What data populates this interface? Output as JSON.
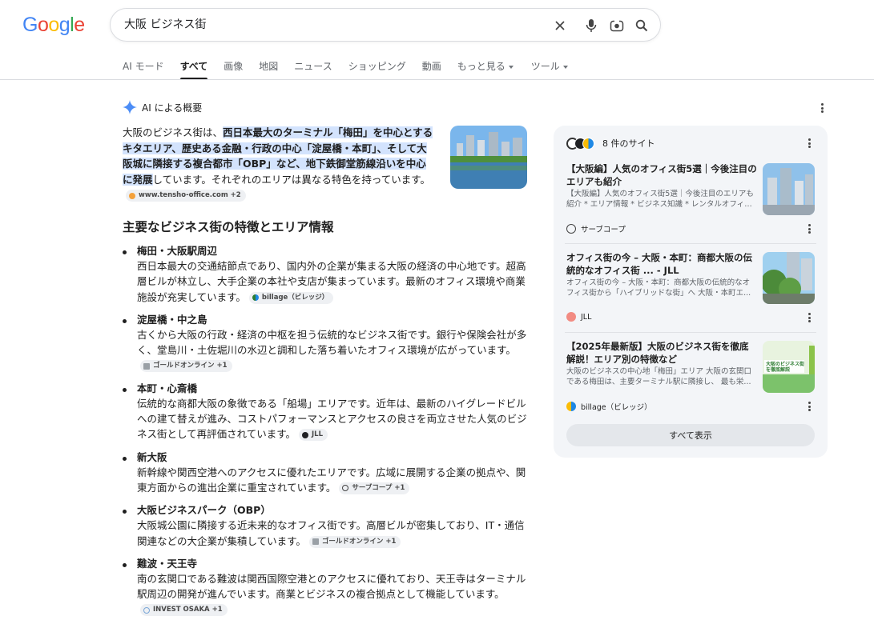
{
  "logo": "Google",
  "search": {
    "query": "大阪 ビジネス街"
  },
  "tabs": [
    {
      "label": "AI モード"
    },
    {
      "label": "すべて"
    },
    {
      "label": "画像"
    },
    {
      "label": "地図"
    },
    {
      "label": "ニュース"
    },
    {
      "label": "ショッピング"
    },
    {
      "label": "動画"
    },
    {
      "label": "もっと見る"
    },
    {
      "label": "ツール"
    }
  ],
  "ai": {
    "header": "AI による概要",
    "intro_pre": "大阪のビジネス街は、",
    "intro_hl": "西日本最大のターミナル「梅田」を中心とするキタエリア、歴史ある金融・行政の中心「淀屋橋・本町」、そして大阪城に隣接する複合都市「OBP」など、地下鉄御堂筋線沿いを中心に発展",
    "intro_post": "しています。それぞれのエリアは異なる特色を持っています。",
    "intro_chip": "www.tensho-office.com +2",
    "heading": "主要なビジネス街の特徴とエリア情報",
    "items": [
      {
        "title": "梅田・大阪駅周辺",
        "body": "西日本最大の交通結節点であり、国内外の企業が集まる大阪の経済の中心地です。超高層ビルが林立し、大手企業の本社や支店が集まっています。最新のオフィス環境や商業施設が充実しています。",
        "chip": "billage（ビレッジ）"
      },
      {
        "title": "淀屋橋・中之島",
        "body": "古くから大阪の行政・経済の中枢を担う伝統的なビジネス街です。銀行や保険会社が多く、堂島川・土佐堀川の水辺と調和した落ち着いたオフィス環境が広がっています。",
        "chip": "ゴールドオンライン +1"
      },
      {
        "title": "本町・心斎橋",
        "body": "伝統的な商都大阪の象徴である「船場」エリアです。近年は、最新のハイグレードビルへの建て替えが進み、コストパフォーマンスとアクセスの良さを両立させた人気のビジネス街として再評価されています。",
        "chip": "JLL"
      },
      {
        "title": "新大阪",
        "body": "新幹線や関西空港へのアクセスに優れたエリアです。広域に展開する企業の拠点や、関東方面からの進出企業に重宝されています。",
        "chip": "サーブコープ +1"
      },
      {
        "title": "大阪ビジネスパーク（OBP）",
        "body": "大阪城公園に隣接する近未来的なオフィス街です。高層ビルが密集しており、IT・通信関連などの大企業が集積しています。",
        "chip": "ゴールドオンライン +1"
      },
      {
        "title": "難波・天王寺",
        "body": "南の玄関口である難波は関西国際空港とのアクセスに優れており、天王寺はターミナル駅周辺の開発が進んでいます。商業とビジネスの複合拠点として機能しています。",
        "chip": "INVEST OSAKA +1"
      }
    ]
  },
  "sources": {
    "header": "8 件のサイト",
    "cards": [
      {
        "title": "【大阪編】人気のオフィス街5選｜今後注目のエリアも紹介",
        "snippet": "【大阪編】人気のオフィス街5選｜今後注目のエリアも紹介 * エリア情報 * ビジネス知識 * レンタルオフィス...",
        "source": "サーブコープ"
      },
      {
        "title": "オフィス街の今 – 大阪・本町：商都大阪の伝統的なオフィス街 ... - JLL",
        "snippet": "オフィス街の今 – 大阪・本町：商都大阪の伝統的なオフィス街から「ハイブリッドな街」へ 大阪・本町エ...",
        "source": "JLL"
      },
      {
        "title": "【2025年最新版】大阪のビジネス街を徹底解説！エリア別の特徴など",
        "snippet": "大阪のビジネスの中心地「梅田」エリア 大阪の玄関口である梅田は、主要ターミナル駅に隣接し、 最も栄...",
        "source": "billage（ビレッジ）",
        "img_text": "大阪のビジネス街を徹底解説"
      }
    ],
    "show_all": "すべて表示"
  },
  "colors": {
    "accent": "#1f1f1f",
    "highlight": "#d3e3fd",
    "panel": "#f3f5f8"
  }
}
